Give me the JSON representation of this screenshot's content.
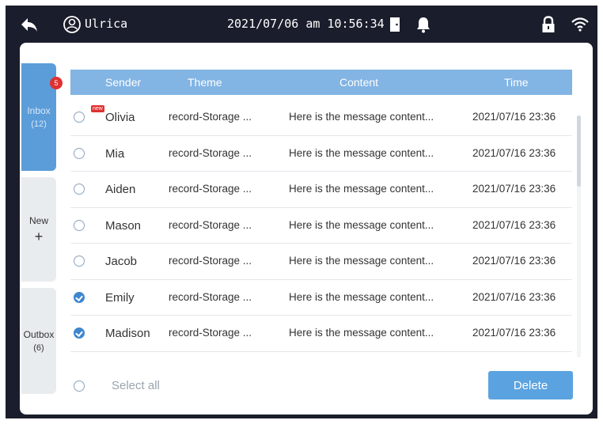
{
  "status_bar": {
    "user_name": "Ulrica",
    "datetime": "2021/07/06 am 10:56:34",
    "icons": [
      "back-arrow-icon",
      "user-icon",
      "door-icon",
      "bell-icon",
      "lock-icon",
      "wifi-icon"
    ]
  },
  "nav": {
    "inbox": {
      "label": "Inbox",
      "count": "(12)",
      "badge": "5"
    },
    "new": {
      "label": "New",
      "icon": "+"
    },
    "outbox": {
      "label": "Outbox",
      "count": "(6)"
    }
  },
  "table": {
    "headers": {
      "sender": "Sender",
      "theme": "Theme",
      "content": "Content",
      "time": "Time"
    },
    "rows": [
      {
        "sender": "Olivia",
        "theme": "record-Storage ...",
        "content": "Here is the message content...",
        "time": "2021/07/16 23:36",
        "checked": false,
        "new": true,
        "new_label": "new"
      },
      {
        "sender": "Mia",
        "theme": "record-Storage ...",
        "content": "Here is the message content...",
        "time": "2021/07/16 23:36",
        "checked": false
      },
      {
        "sender": "Aiden",
        "theme": "record-Storage ...",
        "content": "Here is the message content...",
        "time": "2021/07/16 23:36",
        "checked": false
      },
      {
        "sender": "Mason",
        "theme": "record-Storage ...",
        "content": "Here is the message content...",
        "time": "2021/07/16 23:36",
        "checked": false
      },
      {
        "sender": "Jacob",
        "theme": "record-Storage ...",
        "content": "Here is the message content...",
        "time": "2021/07/16 23:36",
        "checked": false
      },
      {
        "sender": "Emily",
        "theme": "record-Storage ...",
        "content": "Here is the message content...",
        "time": "2021/07/16 23:36",
        "checked": true
      },
      {
        "sender": "Madison",
        "theme": "record-Storage ...",
        "content": "Here is the message content...",
        "time": "2021/07/16 23:36",
        "checked": true
      }
    ]
  },
  "footer": {
    "select_all_label": "Select all",
    "delete_label": "Delete"
  },
  "colors": {
    "accent": "#5b9dd9",
    "header": "#82b4e4",
    "badge": "#e03131",
    "frame": "#1a1d2b"
  }
}
